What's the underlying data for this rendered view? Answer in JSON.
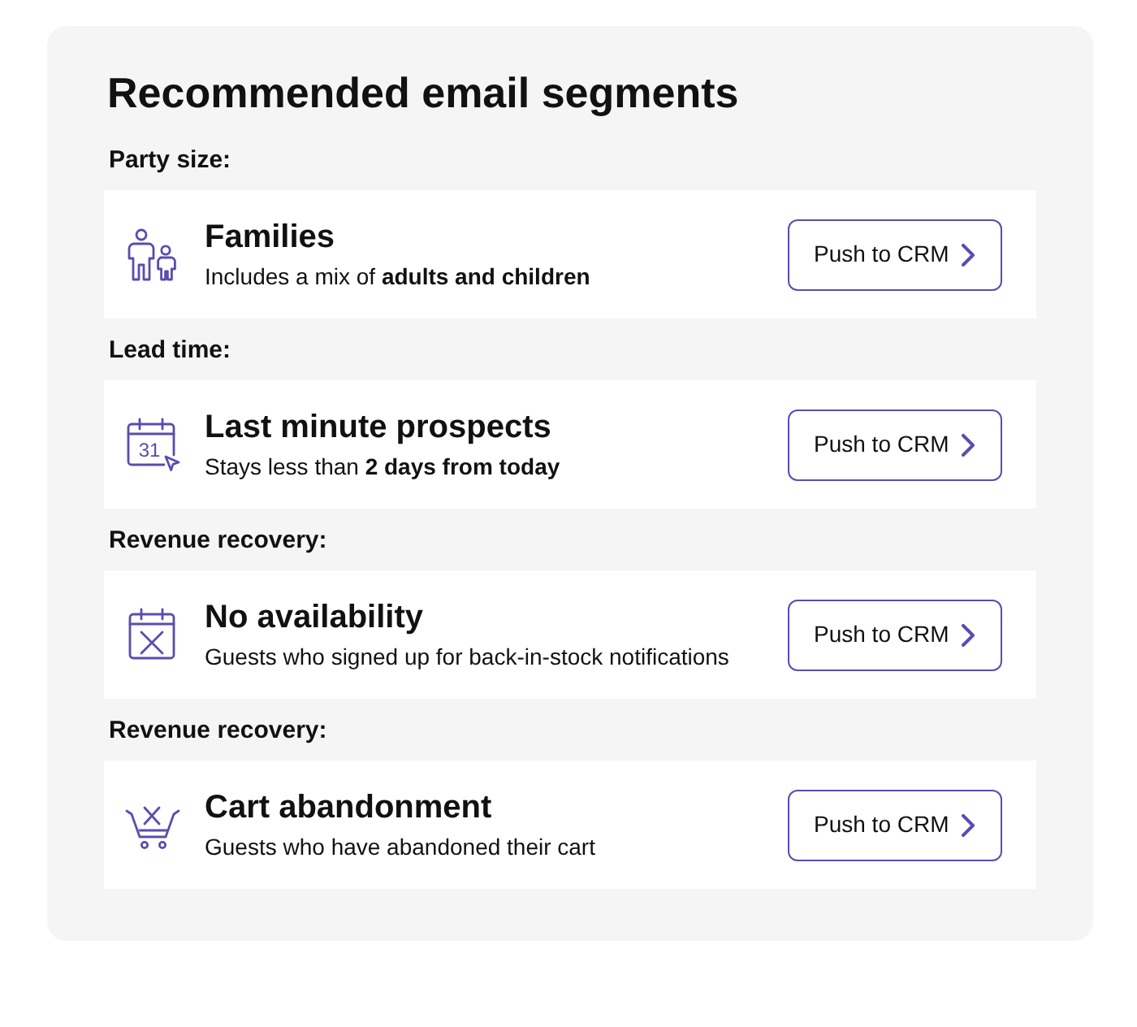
{
  "title": "Recommended email segments",
  "segments": [
    {
      "category": "Party size:",
      "icon": {
        "kind": "family"
      },
      "title": "Families",
      "description": "Includes a mix of **adults and children**",
      "button": "Push to CRM"
    },
    {
      "category": "Lead time:",
      "icon": {
        "kind": "calendar-date",
        "text": "31"
      },
      "title": "Last minute prospects",
      "description": "Stays less than **2 days from today**",
      "button": "Push to CRM"
    },
    {
      "category": "Revenue recovery:",
      "icon": {
        "kind": "calendar-x"
      },
      "title": "No availability",
      "description": "Guests who signed up for back-in-stock notifications",
      "button": "Push to CRM"
    },
    {
      "category": "Revenue recovery:",
      "icon": {
        "kind": "cart-x"
      },
      "title": "Cart abandonment",
      "description": "Guests who have abandoned their cart",
      "button": "Push to CRM"
    }
  ]
}
